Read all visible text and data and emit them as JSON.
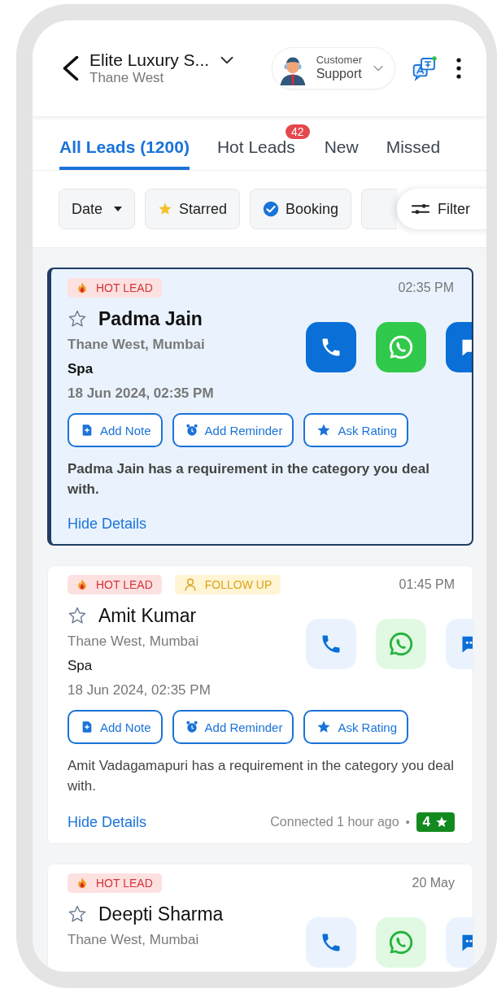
{
  "header": {
    "title": "Elite Luxury S...",
    "subtitle": "Thane West",
    "support": {
      "line1": "Customer",
      "line2": "Support"
    }
  },
  "tabs": [
    {
      "label": "All Leads (1200)",
      "selected": true
    },
    {
      "label": "Hot Leads",
      "selected": false,
      "badge": "42"
    },
    {
      "label": "New",
      "selected": false
    },
    {
      "label": "Missed",
      "selected": false
    }
  ],
  "filters": [
    {
      "kind": "dropdown",
      "label": "Date"
    },
    {
      "kind": "starred",
      "label": "Starred"
    },
    {
      "kind": "booking",
      "label": "Booking"
    },
    {
      "kind": "hidden"
    },
    {
      "kind": "filter",
      "label": "Filter"
    }
  ],
  "leads": [
    {
      "selected": true,
      "starred": false,
      "tags": [
        {
          "kind": "hot",
          "label": "HOT LEAD"
        }
      ],
      "time": "02:35 PM",
      "name": "Padma Jain",
      "location": "Thane West, Mumbai",
      "category": "Spa",
      "datetime": "18 Jun 2024, 02:35 PM",
      "actions": [
        {
          "kind": "note",
          "label": "Add Note"
        },
        {
          "kind": "reminder",
          "label": "Add Reminder"
        },
        {
          "kind": "rating",
          "label": "Ask Rating"
        }
      ],
      "description": "Padma Jain has a requirement in the category you deal with.",
      "link": "Hide Details"
    },
    {
      "selected": false,
      "starred": false,
      "tags": [
        {
          "kind": "hot",
          "label": "HOT LEAD"
        },
        {
          "kind": "follow_up",
          "label": "FOLLOW UP"
        }
      ],
      "time": "01:45 PM",
      "name": "Amit Kumar",
      "location": "Thane West, Mumbai",
      "category": "Spa",
      "datetime": "18 Jun 2024, 02:35 PM",
      "actions": [
        {
          "kind": "note",
          "label": "Add Note"
        },
        {
          "kind": "reminder",
          "label": "Add Reminder"
        },
        {
          "kind": "rating",
          "label": "Ask Rating"
        }
      ],
      "description": "Amit Vadagamapuri has a requirement in the category you deal with.",
      "link": "Hide Details",
      "connected": "Connected 1 hour ago",
      "separator": "•",
      "rating": "4"
    },
    {
      "selected": false,
      "starred": false,
      "tags": [
        {
          "kind": "hot",
          "label": "HOT LEAD"
        }
      ],
      "time": "20 May",
      "name": "Deepti Sharma",
      "location": "Thane West, Mumbai"
    }
  ]
}
